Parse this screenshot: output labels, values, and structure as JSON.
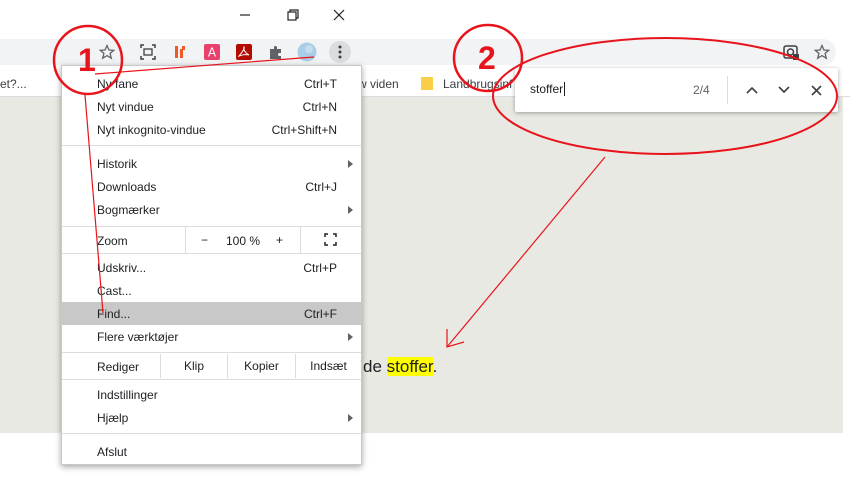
{
  "toolbar": {
    "bookmarks": [
      {
        "label": "et?..."
      },
      {
        "label": "w viden"
      },
      {
        "label": "Landbrugsinf"
      }
    ]
  },
  "page": {
    "text_before": "de ",
    "highlight": "stoffer",
    "text_after": "."
  },
  "findbar": {
    "query": "stoffer",
    "count": "2/4"
  },
  "menu": {
    "new_tab": {
      "label": "Ny fane",
      "shortcut": "Ctrl+T"
    },
    "new_window": {
      "label": "Nyt vindue",
      "shortcut": "Ctrl+N"
    },
    "incognito": {
      "label": "Nyt inkognito-vindue",
      "shortcut": "Ctrl+Shift+N"
    },
    "history": {
      "label": "Historik"
    },
    "downloads": {
      "label": "Downloads",
      "shortcut": "Ctrl+J"
    },
    "bookmarks": {
      "label": "Bogmærker"
    },
    "zoom": {
      "label": "Zoom",
      "minus": "−",
      "value": "100 %",
      "plus": "+"
    },
    "print": {
      "label": "Udskriv...",
      "shortcut": "Ctrl+P"
    },
    "cast": {
      "label": "Cast..."
    },
    "find": {
      "label": "Find...",
      "shortcut": "Ctrl+F"
    },
    "more_tools": {
      "label": "Flere værktøjer"
    },
    "edit": {
      "label": "Rediger",
      "cut": "Klip",
      "copy": "Kopier",
      "paste": "Indsæt"
    },
    "settings": {
      "label": "Indstillinger"
    },
    "help": {
      "label": "Hjælp"
    },
    "exit": {
      "label": "Afslut"
    }
  },
  "annotations": {
    "step1": "1",
    "step2": "2"
  },
  "colors": {
    "annotation": "#e8141b",
    "highlight": "#ffff00",
    "menu_active": "#c8c8c8",
    "content_bg": "#e9e9e4"
  },
  "icons": [
    "minimize-icon",
    "restore-icon",
    "close-icon",
    "star-icon",
    "screenshot-icon",
    "extension-icon",
    "puzzle-icon",
    "profile-icon",
    "kebab-menu-icon",
    "lens-icon",
    "folder-icon",
    "chevron-up-icon",
    "chevron-down-icon",
    "fullscreen-icon"
  ]
}
